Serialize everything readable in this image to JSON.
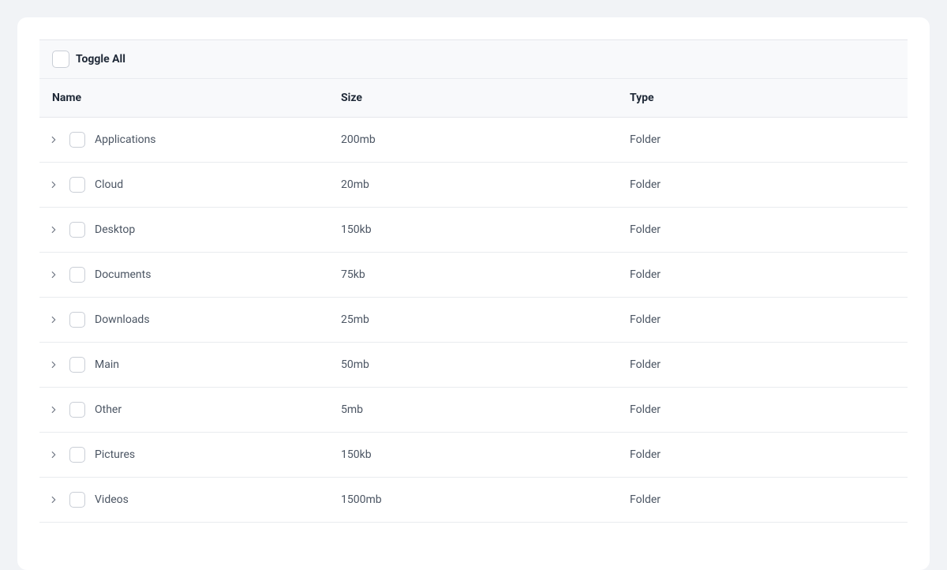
{
  "toggleAll": {
    "label": "Toggle All"
  },
  "headers": {
    "name": "Name",
    "size": "Size",
    "type": "Type"
  },
  "rows": [
    {
      "name": "Applications",
      "size": "200mb",
      "type": "Folder"
    },
    {
      "name": "Cloud",
      "size": "20mb",
      "type": "Folder"
    },
    {
      "name": "Desktop",
      "size": "150kb",
      "type": "Folder"
    },
    {
      "name": "Documents",
      "size": "75kb",
      "type": "Folder"
    },
    {
      "name": "Downloads",
      "size": "25mb",
      "type": "Folder"
    },
    {
      "name": "Main",
      "size": "50mb",
      "type": "Folder"
    },
    {
      "name": "Other",
      "size": "5mb",
      "type": "Folder"
    },
    {
      "name": "Pictures",
      "size": "150kb",
      "type": "Folder"
    },
    {
      "name": "Videos",
      "size": "1500mb",
      "type": "Folder"
    }
  ]
}
